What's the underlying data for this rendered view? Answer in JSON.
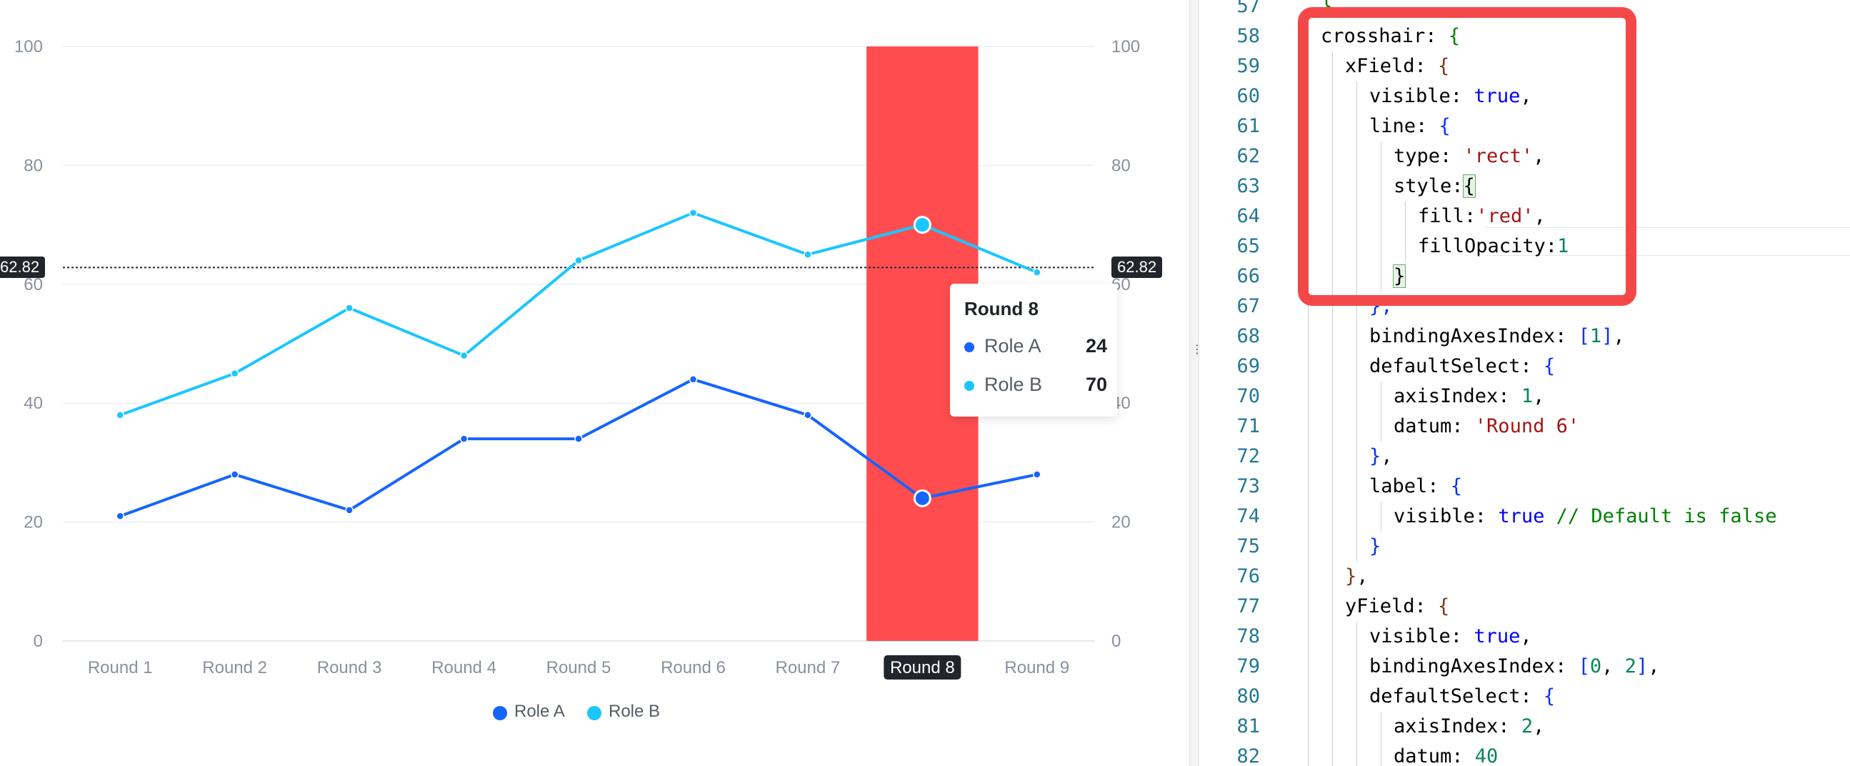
{
  "chart": {
    "y_ticks_left": [
      "100",
      "80",
      "60",
      "40",
      "20",
      "0"
    ],
    "y_ticks_right": [
      "100",
      "80",
      "60",
      "40",
      "20",
      "0"
    ],
    "crosshair_y_value": "62.82",
    "highlighted_category": "Round 8",
    "crosshair_fill": "#ff4d4f"
  },
  "chart_data": {
    "type": "line",
    "categories": [
      "Round 1",
      "Round 2",
      "Round 3",
      "Round 4",
      "Round 5",
      "Round 6",
      "Round 7",
      "Round 8",
      "Round 9"
    ],
    "series": [
      {
        "name": "Role A",
        "color": "#1664ff",
        "values": [
          21,
          28,
          22,
          34,
          34,
          44,
          38,
          24,
          28
        ]
      },
      {
        "name": "Role B",
        "color": "#1ac6ff",
        "values": [
          38,
          45,
          56,
          48,
          64,
          72,
          65,
          70,
          62
        ]
      }
    ],
    "ylim": [
      0,
      100
    ],
    "grid": true,
    "legend_position": "bottom-center"
  },
  "tooltip": {
    "title": "Round 8",
    "rows": [
      {
        "name": "Role A",
        "value": "24",
        "color": "#1664ff"
      },
      {
        "name": "Role B",
        "value": "70",
        "color": "#1ac6ff"
      }
    ]
  },
  "legend": [
    {
      "label": "Role A",
      "color": "#1664ff"
    },
    {
      "label": "Role B",
      "color": "#1ac6ff"
    }
  ],
  "divider": {
    "grip": "⋮⋮"
  },
  "code": {
    "lines": [
      {
        "n": "57",
        "depth": 0,
        "tokens": [
          [
            "br1",
            "}"
          ]
        ]
      },
      {
        "n": "58",
        "depth": 1,
        "tokens": [
          [
            "key",
            "crosshair: "
          ],
          [
            "br1",
            "{"
          ]
        ]
      },
      {
        "n": "59",
        "depth": 2,
        "tokens": [
          [
            "key",
            "xField: "
          ],
          [
            "br2",
            "{"
          ]
        ]
      },
      {
        "n": "60",
        "depth": 3,
        "tokens": [
          [
            "key",
            "visible: "
          ],
          [
            "kw",
            "true"
          ],
          [
            "key",
            ","
          ]
        ]
      },
      {
        "n": "61",
        "depth": 3,
        "tokens": [
          [
            "key",
            "line: "
          ],
          [
            "br3",
            "{"
          ]
        ]
      },
      {
        "n": "62",
        "depth": 4,
        "tokens": [
          [
            "key",
            "type: "
          ],
          [
            "str",
            "'rect'"
          ],
          [
            "key",
            ","
          ]
        ]
      },
      {
        "n": "63",
        "depth": 4,
        "tokens": [
          [
            "key",
            "style:"
          ],
          [
            "brh",
            "{"
          ]
        ]
      },
      {
        "n": "64",
        "depth": 5,
        "tokens": [
          [
            "key",
            "fill:"
          ],
          [
            "str",
            "'red'"
          ],
          [
            "key",
            ","
          ]
        ]
      },
      {
        "n": "65",
        "depth": 5,
        "tokens": [
          [
            "key",
            "fillOpacity:"
          ],
          [
            "num",
            "1"
          ]
        ]
      },
      {
        "n": "66",
        "depth": 4,
        "tokens": [
          [
            "brh",
            "}"
          ]
        ]
      },
      {
        "n": "67",
        "depth": 3,
        "tokens": [
          [
            "br3",
            "},"
          ]
        ]
      },
      {
        "n": "68",
        "depth": 3,
        "tokens": [
          [
            "key",
            "bindingAxesIndex: "
          ],
          [
            "br3",
            "["
          ],
          [
            "num",
            "1"
          ],
          [
            "br3",
            "]"
          ],
          [
            "key",
            ","
          ]
        ]
      },
      {
        "n": "69",
        "depth": 3,
        "tokens": [
          [
            "key",
            "defaultSelect: "
          ],
          [
            "br3",
            "{"
          ]
        ]
      },
      {
        "n": "70",
        "depth": 4,
        "tokens": [
          [
            "key",
            "axisIndex: "
          ],
          [
            "num",
            "1"
          ],
          [
            "key",
            ","
          ]
        ]
      },
      {
        "n": "71",
        "depth": 4,
        "tokens": [
          [
            "key",
            "datum: "
          ],
          [
            "str",
            "'Round 6'"
          ]
        ]
      },
      {
        "n": "72",
        "depth": 3,
        "tokens": [
          [
            "br3",
            "}"
          ],
          [
            "key",
            ","
          ]
        ]
      },
      {
        "n": "73",
        "depth": 3,
        "tokens": [
          [
            "key",
            "label: "
          ],
          [
            "br3",
            "{"
          ]
        ]
      },
      {
        "n": "74",
        "depth": 4,
        "tokens": [
          [
            "key",
            "visible: "
          ],
          [
            "kw",
            "true"
          ],
          [
            "cmt",
            " // Default is false"
          ]
        ]
      },
      {
        "n": "75",
        "depth": 3,
        "tokens": [
          [
            "br3",
            "}"
          ]
        ]
      },
      {
        "n": "76",
        "depth": 2,
        "tokens": [
          [
            "br2",
            "}"
          ],
          [
            "key",
            ","
          ]
        ]
      },
      {
        "n": "77",
        "depth": 2,
        "tokens": [
          [
            "key",
            "yField: "
          ],
          [
            "br2",
            "{"
          ]
        ]
      },
      {
        "n": "78",
        "depth": 3,
        "tokens": [
          [
            "key",
            "visible: "
          ],
          [
            "kw",
            "true"
          ],
          [
            "key",
            ","
          ]
        ]
      },
      {
        "n": "79",
        "depth": 3,
        "tokens": [
          [
            "key",
            "bindingAxesIndex: "
          ],
          [
            "br3",
            "["
          ],
          [
            "num",
            "0"
          ],
          [
            "key",
            ", "
          ],
          [
            "num",
            "2"
          ],
          [
            "br3",
            "]"
          ],
          [
            "key",
            ","
          ]
        ]
      },
      {
        "n": "80",
        "depth": 3,
        "tokens": [
          [
            "key",
            "defaultSelect: "
          ],
          [
            "br3",
            "{"
          ]
        ]
      },
      {
        "n": "81",
        "depth": 4,
        "tokens": [
          [
            "key",
            "axisIndex: "
          ],
          [
            "num",
            "2"
          ],
          [
            "key",
            ","
          ]
        ]
      },
      {
        "n": "82",
        "depth": 4,
        "tokens": [
          [
            "key",
            "datum: "
          ],
          [
            "num",
            "40"
          ]
        ]
      }
    ]
  }
}
